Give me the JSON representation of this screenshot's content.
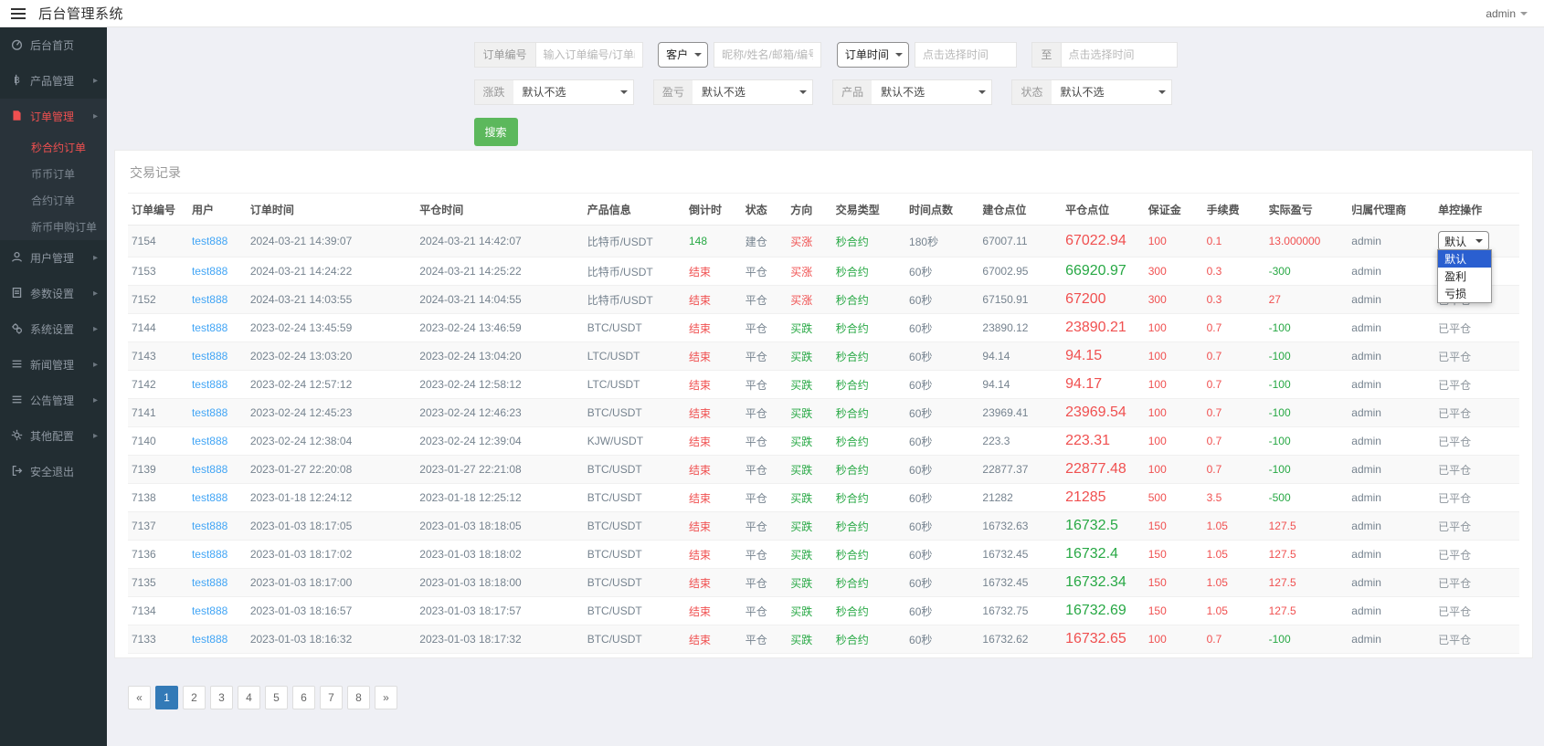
{
  "topbar": {
    "title": "后台管理系统",
    "user": "admin"
  },
  "sidebar": {
    "items": [
      {
        "icon": "dashboard-icon",
        "label": "后台首页",
        "arrow": false,
        "active": false
      },
      {
        "icon": "product-icon",
        "label": "产品管理",
        "arrow": true,
        "active": false
      },
      {
        "icon": "order-icon",
        "label": "订单管理",
        "arrow": true,
        "active": true,
        "children": [
          {
            "label": "秒合约订单",
            "active": true
          },
          {
            "label": "币币订单",
            "active": false
          },
          {
            "label": "合约订单",
            "active": false
          },
          {
            "label": "新币申购订单",
            "active": false
          }
        ]
      },
      {
        "icon": "user-icon",
        "label": "用户管理",
        "arrow": true,
        "active": false
      },
      {
        "icon": "params-icon",
        "label": "参数设置",
        "arrow": true,
        "active": false
      },
      {
        "icon": "system-icon",
        "label": "系统设置",
        "arrow": true,
        "active": false
      },
      {
        "icon": "news-icon",
        "label": "新闻管理",
        "arrow": true,
        "active": false
      },
      {
        "icon": "notice-icon",
        "label": "公告管理",
        "arrow": true,
        "active": false
      },
      {
        "icon": "config-icon",
        "label": "其他配置",
        "arrow": true,
        "active": false
      },
      {
        "icon": "logout-icon",
        "label": "安全退出",
        "arrow": false,
        "active": false
      }
    ]
  },
  "filters": {
    "order_no_label": "订单编号",
    "order_no_placeholder": "输入订单编号/订单id",
    "customer_select": "客户",
    "customer_placeholder": "昵称/姓名/邮箱/编号",
    "time_select": "订单时间",
    "time_from_placeholder": "点击选择时间",
    "to_label": "至",
    "time_to_placeholder": "点击选择时间",
    "updown_label": "涨跌",
    "updown_value": "默认不选",
    "profit_label": "盈亏",
    "profit_value": "默认不选",
    "product_label": "产品",
    "product_value": "默认不选",
    "status_label": "状态",
    "status_value": "默认不选",
    "search_label": "搜索"
  },
  "table": {
    "title": "交易记录",
    "headers": [
      "订单编号",
      "用户",
      "订单时间",
      "平仓时间",
      "产品信息",
      "倒计时",
      "状态",
      "方向",
      "交易类型",
      "时间点数",
      "建仓点位",
      "平仓点位",
      "保证金",
      "手续费",
      "实际盈亏",
      "归属代理商",
      "单控操作"
    ],
    "closed_label": "已平仓",
    "action_dropdown": {
      "selected": "默认",
      "options": [
        "默认",
        "盈利",
        "亏损"
      ],
      "highlighted": "默认"
    },
    "rows": [
      {
        "id": "7154",
        "user": "test888",
        "open_time": "2024-03-21 14:39:07",
        "close_time": "2024-03-21 14:42:07",
        "product": "比特币/USDT",
        "countdown": "148",
        "countdown_color": "green",
        "status": "建仓",
        "direction": "买涨",
        "direction_color": "red",
        "trade_type": "秒合约",
        "duration": "180秒",
        "open_price": "67007.11",
        "close_price": "67022.94",
        "close_price_color": "red",
        "margin": "100",
        "fee": "0.1",
        "profit": "13.000000",
        "profit_color": "red",
        "agent": "admin",
        "action": "select"
      },
      {
        "id": "7153",
        "user": "test888",
        "open_time": "2024-03-21 14:24:22",
        "close_time": "2024-03-21 14:25:22",
        "product": "比特币/USDT",
        "countdown": "结束",
        "countdown_color": "red",
        "status": "平仓",
        "direction": "买涨",
        "direction_color": "red",
        "trade_type": "秒合约",
        "duration": "60秒",
        "open_price": "67002.95",
        "close_price": "66920.97",
        "close_price_color": "green",
        "margin": "300",
        "fee": "0.3",
        "profit": "-300",
        "profit_color": "green",
        "agent": "admin",
        "action": "closed"
      },
      {
        "id": "7152",
        "user": "test888",
        "open_time": "2024-03-21 14:03:55",
        "close_time": "2024-03-21 14:04:55",
        "product": "比特币/USDT",
        "countdown": "结束",
        "countdown_color": "red",
        "status": "平仓",
        "direction": "买涨",
        "direction_color": "red",
        "trade_type": "秒合约",
        "duration": "60秒",
        "open_price": "67150.91",
        "close_price": "67200",
        "close_price_color": "red",
        "margin": "300",
        "fee": "0.3",
        "profit": "27",
        "profit_color": "red",
        "agent": "admin",
        "action": "closed"
      },
      {
        "id": "7144",
        "user": "test888",
        "open_time": "2023-02-24 13:45:59",
        "close_time": "2023-02-24 13:46:59",
        "product": "BTC/USDT",
        "countdown": "结束",
        "countdown_color": "red",
        "status": "平仓",
        "direction": "买跌",
        "direction_color": "green",
        "trade_type": "秒合约",
        "duration": "60秒",
        "open_price": "23890.12",
        "close_price": "23890.21",
        "close_price_color": "red",
        "margin": "100",
        "fee": "0.7",
        "profit": "-100",
        "profit_color": "green",
        "agent": "admin",
        "action": "closed"
      },
      {
        "id": "7143",
        "user": "test888",
        "open_time": "2023-02-24 13:03:20",
        "close_time": "2023-02-24 13:04:20",
        "product": "LTC/USDT",
        "countdown": "结束",
        "countdown_color": "red",
        "status": "平仓",
        "direction": "买跌",
        "direction_color": "green",
        "trade_type": "秒合约",
        "duration": "60秒",
        "open_price": "94.14",
        "close_price": "94.15",
        "close_price_color": "red",
        "margin": "100",
        "fee": "0.7",
        "profit": "-100",
        "profit_color": "green",
        "agent": "admin",
        "action": "closed"
      },
      {
        "id": "7142",
        "user": "test888",
        "open_time": "2023-02-24 12:57:12",
        "close_time": "2023-02-24 12:58:12",
        "product": "LTC/USDT",
        "countdown": "结束",
        "countdown_color": "red",
        "status": "平仓",
        "direction": "买跌",
        "direction_color": "green",
        "trade_type": "秒合约",
        "duration": "60秒",
        "open_price": "94.14",
        "close_price": "94.17",
        "close_price_color": "red",
        "margin": "100",
        "fee": "0.7",
        "profit": "-100",
        "profit_color": "green",
        "agent": "admin",
        "action": "closed"
      },
      {
        "id": "7141",
        "user": "test888",
        "open_time": "2023-02-24 12:45:23",
        "close_time": "2023-02-24 12:46:23",
        "product": "BTC/USDT",
        "countdown": "结束",
        "countdown_color": "red",
        "status": "平仓",
        "direction": "买跌",
        "direction_color": "green",
        "trade_type": "秒合约",
        "duration": "60秒",
        "open_price": "23969.41",
        "close_price": "23969.54",
        "close_price_color": "red",
        "margin": "100",
        "fee": "0.7",
        "profit": "-100",
        "profit_color": "green",
        "agent": "admin",
        "action": "closed"
      },
      {
        "id": "7140",
        "user": "test888",
        "open_time": "2023-02-24 12:38:04",
        "close_time": "2023-02-24 12:39:04",
        "product": "KJW/USDT",
        "countdown": "结束",
        "countdown_color": "red",
        "status": "平仓",
        "direction": "买跌",
        "direction_color": "green",
        "trade_type": "秒合约",
        "duration": "60秒",
        "open_price": "223.3",
        "close_price": "223.31",
        "close_price_color": "red",
        "margin": "100",
        "fee": "0.7",
        "profit": "-100",
        "profit_color": "green",
        "agent": "admin",
        "action": "closed"
      },
      {
        "id": "7139",
        "user": "test888",
        "open_time": "2023-01-27 22:20:08",
        "close_time": "2023-01-27 22:21:08",
        "product": "BTC/USDT",
        "countdown": "结束",
        "countdown_color": "red",
        "status": "平仓",
        "direction": "买跌",
        "direction_color": "green",
        "trade_type": "秒合约",
        "duration": "60秒",
        "open_price": "22877.37",
        "close_price": "22877.48",
        "close_price_color": "red",
        "margin": "100",
        "fee": "0.7",
        "profit": "-100",
        "profit_color": "green",
        "agent": "admin",
        "action": "closed"
      },
      {
        "id": "7138",
        "user": "test888",
        "open_time": "2023-01-18 12:24:12",
        "close_time": "2023-01-18 12:25:12",
        "product": "BTC/USDT",
        "countdown": "结束",
        "countdown_color": "red",
        "status": "平仓",
        "direction": "买跌",
        "direction_color": "green",
        "trade_type": "秒合约",
        "duration": "60秒",
        "open_price": "21282",
        "close_price": "21285",
        "close_price_color": "red",
        "margin": "500",
        "fee": "3.5",
        "profit": "-500",
        "profit_color": "green",
        "agent": "admin",
        "action": "closed"
      },
      {
        "id": "7137",
        "user": "test888",
        "open_time": "2023-01-03 18:17:05",
        "close_time": "2023-01-03 18:18:05",
        "product": "BTC/USDT",
        "countdown": "结束",
        "countdown_color": "red",
        "status": "平仓",
        "direction": "买跌",
        "direction_color": "green",
        "trade_type": "秒合约",
        "duration": "60秒",
        "open_price": "16732.63",
        "close_price": "16732.5",
        "close_price_color": "green",
        "margin": "150",
        "fee": "1.05",
        "profit": "127.5",
        "profit_color": "red",
        "agent": "admin",
        "action": "closed"
      },
      {
        "id": "7136",
        "user": "test888",
        "open_time": "2023-01-03 18:17:02",
        "close_time": "2023-01-03 18:18:02",
        "product": "BTC/USDT",
        "countdown": "结束",
        "countdown_color": "red",
        "status": "平仓",
        "direction": "买跌",
        "direction_color": "green",
        "trade_type": "秒合约",
        "duration": "60秒",
        "open_price": "16732.45",
        "close_price": "16732.4",
        "close_price_color": "green",
        "margin": "150",
        "fee": "1.05",
        "profit": "127.5",
        "profit_color": "red",
        "agent": "admin",
        "action": "closed"
      },
      {
        "id": "7135",
        "user": "test888",
        "open_time": "2023-01-03 18:17:00",
        "close_time": "2023-01-03 18:18:00",
        "product": "BTC/USDT",
        "countdown": "结束",
        "countdown_color": "red",
        "status": "平仓",
        "direction": "买跌",
        "direction_color": "green",
        "trade_type": "秒合约",
        "duration": "60秒",
        "open_price": "16732.45",
        "close_price": "16732.34",
        "close_price_color": "green",
        "margin": "150",
        "fee": "1.05",
        "profit": "127.5",
        "profit_color": "red",
        "agent": "admin",
        "action": "closed"
      },
      {
        "id": "7134",
        "user": "test888",
        "open_time": "2023-01-03 18:16:57",
        "close_time": "2023-01-03 18:17:57",
        "product": "BTC/USDT",
        "countdown": "结束",
        "countdown_color": "red",
        "status": "平仓",
        "direction": "买跌",
        "direction_color": "green",
        "trade_type": "秒合约",
        "duration": "60秒",
        "open_price": "16732.75",
        "close_price": "16732.69",
        "close_price_color": "green",
        "margin": "150",
        "fee": "1.05",
        "profit": "127.5",
        "profit_color": "red",
        "agent": "admin",
        "action": "closed"
      },
      {
        "id": "7133",
        "user": "test888",
        "open_time": "2023-01-03 18:16:32",
        "close_time": "2023-01-03 18:17:32",
        "product": "BTC/USDT",
        "countdown": "结束",
        "countdown_color": "red",
        "status": "平仓",
        "direction": "买跌",
        "direction_color": "green",
        "trade_type": "秒合约",
        "duration": "60秒",
        "open_price": "16732.62",
        "close_price": "16732.65",
        "close_price_color": "red",
        "margin": "100",
        "fee": "0.7",
        "profit": "-100",
        "profit_color": "green",
        "agent": "admin",
        "action": "closed"
      }
    ]
  },
  "pagination": {
    "prev": "«",
    "next": "»",
    "pages": [
      "1",
      "2",
      "3",
      "4",
      "5",
      "6",
      "7",
      "8"
    ],
    "active": "1"
  },
  "colors": {
    "accent_blue": "#42a5f5",
    "red": "#f05050",
    "green": "#27a844",
    "sidebar_bg": "#222d32",
    "search_green": "#5cb85c",
    "active_page": "#337ab7"
  }
}
